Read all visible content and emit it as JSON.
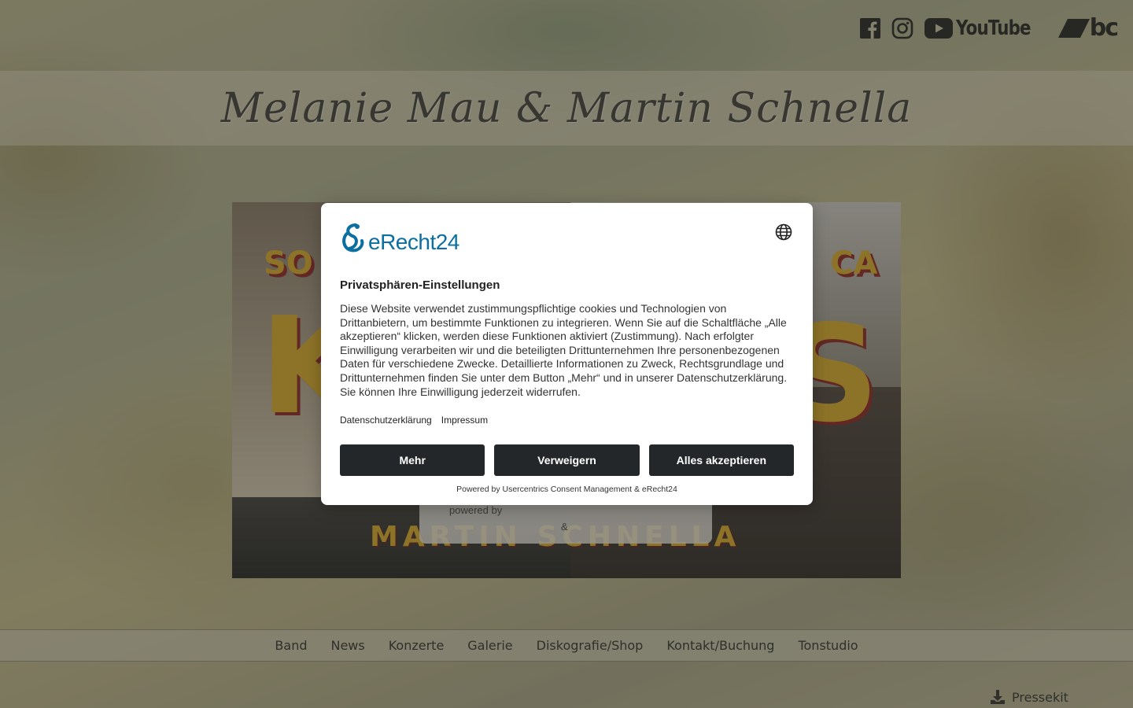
{
  "social": {
    "youtube_label": "YouTube",
    "bandcamp_label": "bc"
  },
  "header": {
    "site_title": "Melanie Mau & Martin Schnella"
  },
  "hero": {
    "line_top_left": "SO",
    "line_top_right": "CA",
    "big_left": "K",
    "big_right": "S",
    "bottom_name": "MARTIN SCHNELLA",
    "card_powered_by": "powered by",
    "card_ampersand": "&"
  },
  "nav": {
    "items": [
      "Band",
      "News",
      "Konzerte",
      "Galerie",
      "Diskografie/Shop",
      "Kontakt/Buchung",
      "Tonstudio"
    ]
  },
  "presskit": {
    "label": "Pressekit"
  },
  "consent": {
    "logo_text": "eRecht24",
    "title": "Privatsphären-Einstellungen",
    "body": "Diese Website verwendet zustimmungspflichtige cookies und Technologien von Drittanbietern, um bestimmte Funktionen zu integrieren. Wenn Sie auf die Schaltfläche „Alle akzeptieren“ klicken, werden diese Funktionen aktiviert (Zustimmung). Nach erfolgter Einwilligung verarbeiten wir und die beteiligten Drittunternehmen Ihre personenbezogenen Daten für verschiedene Zwecke. Detaillierte Informationen zu Zweck, Rechtsgrundlage und Drittunternehmen finden Sie unter dem Button „Mehr“ und in unserer Datenschutzerklärung. Sie können Ihre Einwilligung jederzeit widerrufen.",
    "link_privacy": "Datenschutzerklärung",
    "link_imprint": "Impressum",
    "btn_more": "Mehr",
    "btn_deny": "Verweigern",
    "btn_accept_all": "Alles akzeptieren",
    "powered_by": "Powered by Usercentrics Consent Management & eRecht24"
  }
}
